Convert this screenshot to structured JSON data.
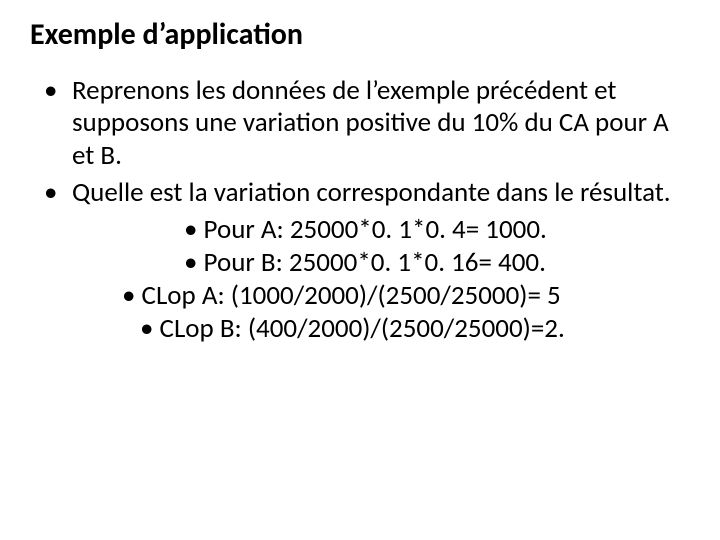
{
  "title": "Exemple d’application",
  "bullets": {
    "b1": "Reprenons les données de l’exemple précédent et supposons une variation positive du 10% du CA pour A et B.",
    "b2": "Quelle est la variation correspondante dans le résultat."
  },
  "sub": {
    "s1": "• Pour A: 25000*0. 1*0. 4= 1000.",
    "s2": "• Pour B: 25000*0. 1*0. 16= 400.",
    "s3": "• CLop A: (1000/2000)/(2500/25000)= 5",
    "s4": "• CLop B: (400/2000)/(2500/25000)=2."
  }
}
